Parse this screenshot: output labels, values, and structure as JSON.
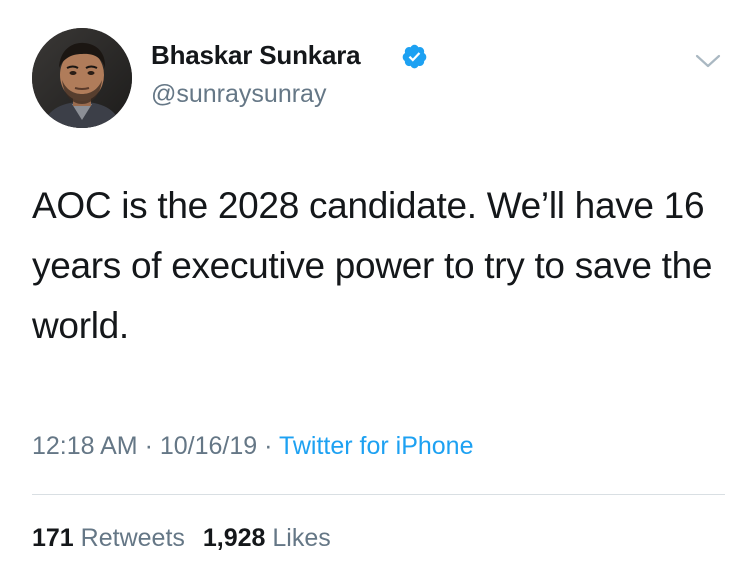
{
  "author": {
    "display_name": "Bhaskar Sunkara",
    "handle": "@sunraysunray",
    "verified_icon": "verified-badge-icon",
    "avatar_icon": "profile-photo"
  },
  "menu": {
    "icon": "chevron-down-icon"
  },
  "tweet": {
    "text": "AOC is the 2028 candidate. We’ll have 16 years of executive power to try to save the world."
  },
  "meta": {
    "time": "12:18 AM",
    "separator": " · ",
    "date": "10/16/19",
    "source": "Twitter for iPhone"
  },
  "stats": {
    "retweets_count": "171",
    "retweets_label": "Retweets",
    "likes_count": "1,928",
    "likes_label": "Likes"
  },
  "colors": {
    "text": "#14171a",
    "secondary": "#657786",
    "accent": "#1da1f2",
    "divider": "#d9dfe3"
  }
}
